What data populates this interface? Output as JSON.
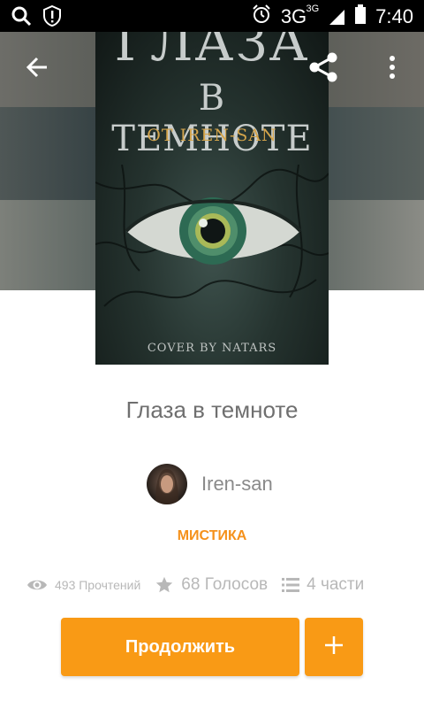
{
  "status_bar": {
    "network": "3G",
    "network_sup": "3G",
    "time": "7:40",
    "icons": [
      "search-icon",
      "alert-shield-icon",
      "alarm-icon",
      "signal-icon",
      "battery-icon"
    ]
  },
  "toolbar": {
    "icons": [
      "back-arrow-icon",
      "share-icon",
      "more-vert-icon"
    ]
  },
  "cover": {
    "title_line1": "ГЛАЗА",
    "title_line2": "В ТЕМНОТЕ",
    "author_line": "ОТ IREN-SAN",
    "credit": "COVER BY NATARS"
  },
  "story": {
    "title": "Глаза в темноте",
    "author": "Iren-san",
    "genre": "МИСТИКА"
  },
  "stats": {
    "reads": "493 Прочтений",
    "votes": "68 Голосов",
    "parts": "4 части"
  },
  "actions": {
    "continue_label": "Продолжить",
    "add_label": "+"
  },
  "colors": {
    "accent": "#f99a15",
    "genre": "#f5911b",
    "muted_text": "#8a8a8a"
  }
}
